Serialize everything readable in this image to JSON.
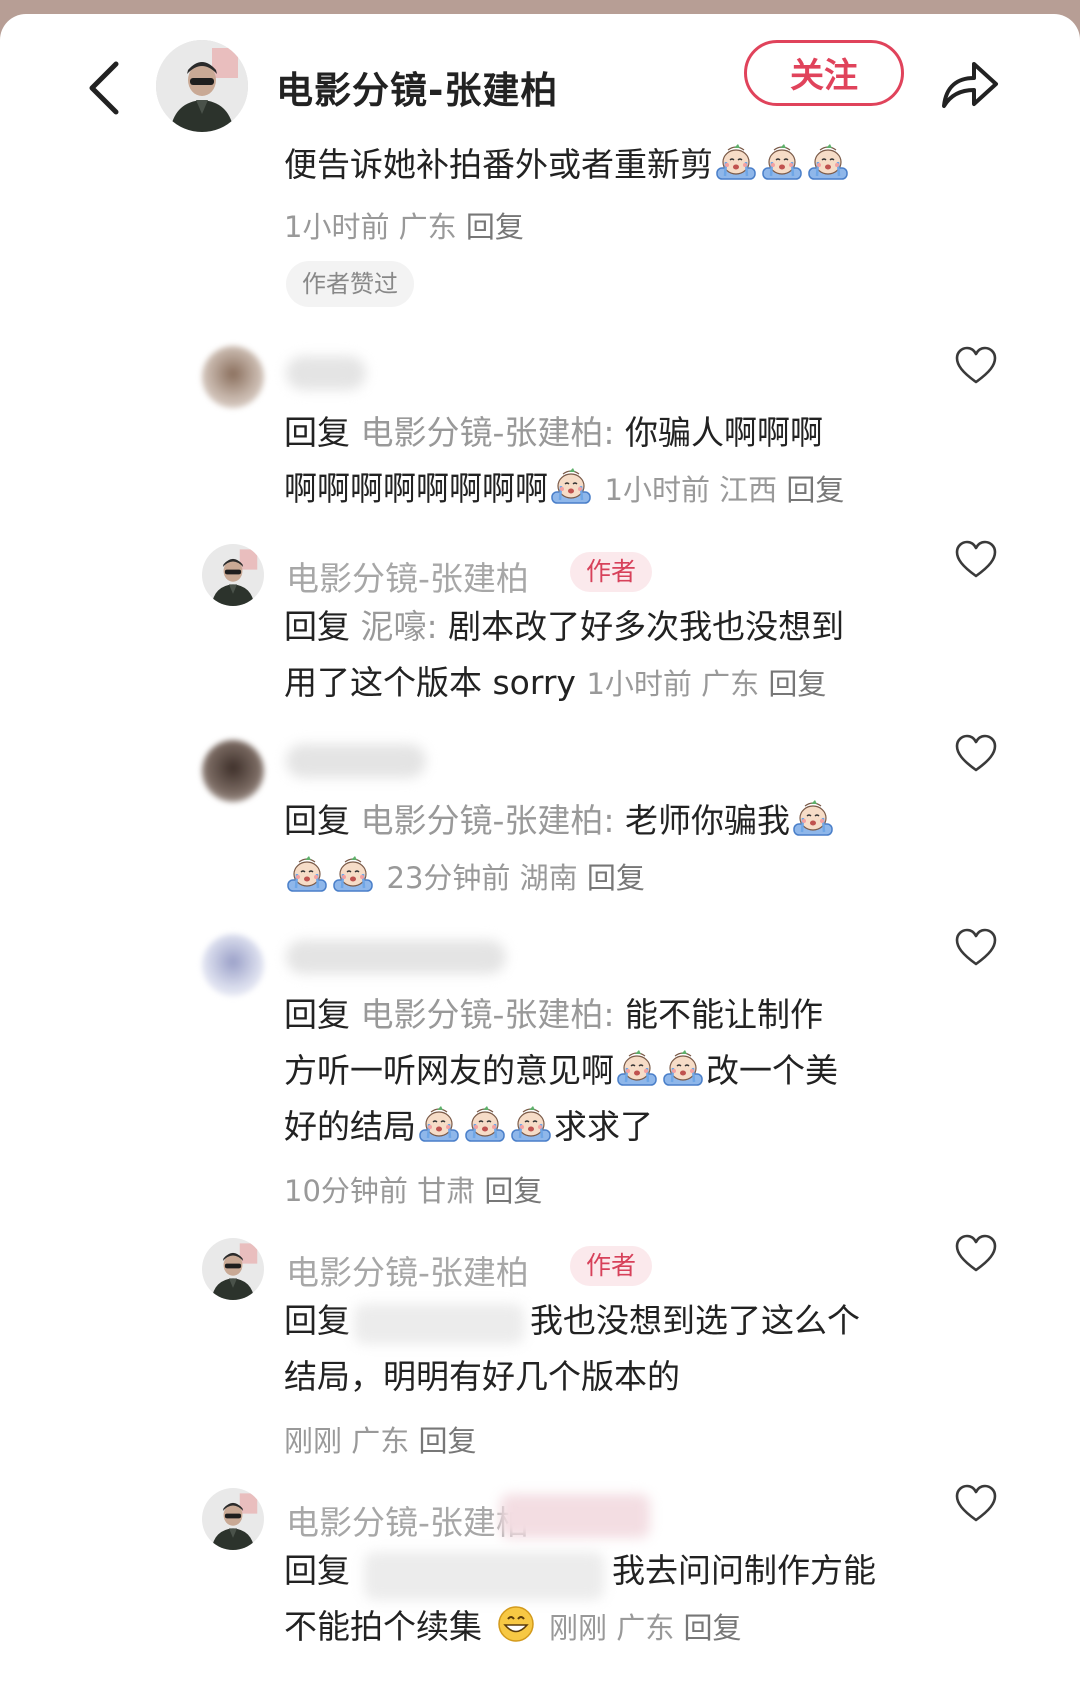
{
  "header": {
    "title": "电影分镜-张建柏",
    "follow_label": "关注"
  },
  "top_comment": {
    "text": "便告诉她补拍番外或者重新剪",
    "meta_time": "1小时前",
    "meta_region": "广东",
    "reply_label": "回复",
    "liked_chip": "作者赞过"
  },
  "comments": [
    {
      "reply_prefix": "回复",
      "reply_to": "电影分镜-张建柏:",
      "line1": "你骗人啊啊啊",
      "line2": "啊啊啊啊啊啊啊啊",
      "time": "1小时前",
      "region": "江西",
      "reply_label": "回复"
    },
    {
      "author": "电影分镜-张建柏",
      "author_tag": "作者",
      "reply_prefix": "回复",
      "reply_to": "泥嚎:",
      "line1": "剧本改了好多次我也没想到",
      "line2": "用了这个版本 sorry",
      "time": "1小时前",
      "region": "广东",
      "reply_label": "回复"
    },
    {
      "reply_prefix": "回复",
      "reply_to": "电影分镜-张建柏:",
      "line1": "老师你骗我",
      "time": "23分钟前",
      "region": "湖南",
      "reply_label": "回复"
    },
    {
      "reply_prefix": "回复",
      "reply_to": "电影分镜-张建柏:",
      "line1": "能不能让制作",
      "line2a": "方听一听网友的意见啊",
      "line2b": "改一个美",
      "line3a": "好的结局",
      "line3b": "求求了",
      "time": "10分钟前",
      "region": "甘肃",
      "reply_label": "回复"
    },
    {
      "author": "电影分镜-张建柏",
      "author_tag": "作者",
      "reply_prefix": "回复",
      "line1": "我也没想到选了这么个",
      "line2": "结局，明明有好几个版本的",
      "time": "刚刚",
      "region": "广东",
      "reply_label": "回复"
    },
    {
      "author": "电影分镜-张建柏",
      "reply_prefix": "回复",
      "line1": "我去问问制作方能",
      "line2": "不能拍个续集",
      "time": "刚刚",
      "region": "广东",
      "reply_label": "回复"
    }
  ],
  "icons": [
    "back-icon",
    "share-icon",
    "heart-icon",
    "crying-emoji-icon",
    "grin-emoji-icon"
  ],
  "colors": {
    "accent": "#e0435b",
    "muted": "#999999"
  }
}
